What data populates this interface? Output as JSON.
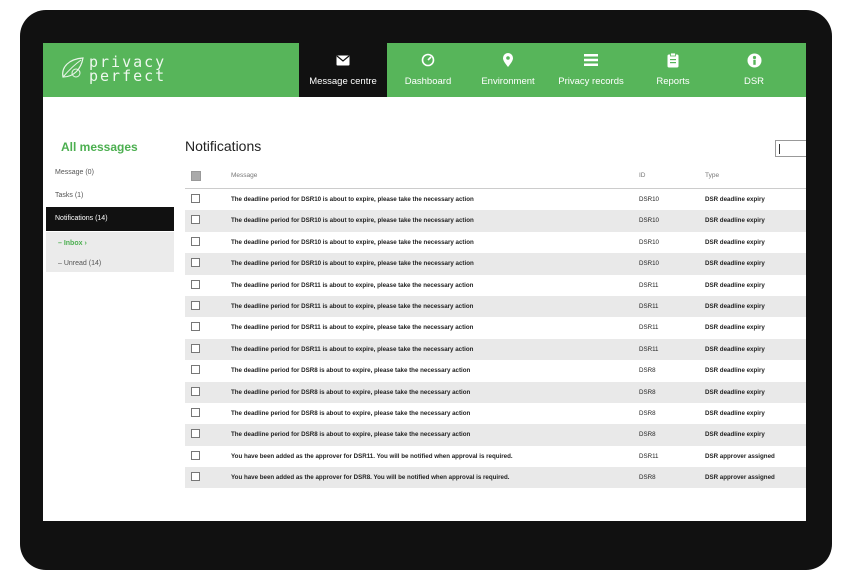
{
  "logo": {
    "line1": "privacy",
    "line2": "perfect"
  },
  "nav": [
    {
      "label": "Message centre",
      "icon": "envelope-icon",
      "active": true
    },
    {
      "label": "Dashboard",
      "icon": "gauge-icon",
      "active": false
    },
    {
      "label": "Environment",
      "icon": "location-pin-icon",
      "active": false
    },
    {
      "label": "Privacy records",
      "icon": "list-icon",
      "active": false
    },
    {
      "label": "Reports",
      "icon": "clipboard-icon",
      "active": false
    },
    {
      "label": "DSR",
      "icon": "person-circle-icon",
      "active": false
    }
  ],
  "sidebar": {
    "title": "All messages",
    "items": [
      {
        "label": "Message (0)"
      },
      {
        "label": "Tasks (1)"
      },
      {
        "label": "Notifications (14)"
      }
    ],
    "sub_items": [
      {
        "label": "– Inbox ›"
      },
      {
        "label": "– Unread (14)"
      }
    ]
  },
  "main": {
    "title": "Notifications",
    "columns": {
      "message": "Message",
      "id": "ID",
      "type": "Type"
    },
    "rows": [
      {
        "message": "The deadline period for DSR10 is about to expire, please take the necessary action",
        "id": "DSR10",
        "type": "DSR deadline expiry"
      },
      {
        "message": "The deadline period for DSR10 is about to expire, please take the necessary action",
        "id": "DSR10",
        "type": "DSR deadline expiry"
      },
      {
        "message": "The deadline period for DSR10 is about to expire, please take the necessary action",
        "id": "DSR10",
        "type": "DSR deadline expiry"
      },
      {
        "message": "The deadline period for DSR10 is about to expire, please take the necessary action",
        "id": "DSR10",
        "type": "DSR deadline expiry"
      },
      {
        "message": "The deadline period for DSR11 is about to expire, please take the necessary action",
        "id": "DSR11",
        "type": "DSR deadline expiry"
      },
      {
        "message": "The deadline period for DSR11 is about to expire, please take the necessary action",
        "id": "DSR11",
        "type": "DSR deadline expiry"
      },
      {
        "message": "The deadline period for DSR11 is about to expire, please take the necessary action",
        "id": "DSR11",
        "type": "DSR deadline expiry"
      },
      {
        "message": "The deadline period for DSR11 is about to expire, please take the necessary action",
        "id": "DSR11",
        "type": "DSR deadline expiry"
      },
      {
        "message": "The deadline period for DSR8 is about to expire, please take the necessary action",
        "id": "DSR8",
        "type": "DSR deadline expiry"
      },
      {
        "message": "The deadline period for DSR8 is about to expire, please take the necessary action",
        "id": "DSR8",
        "type": "DSR deadline expiry"
      },
      {
        "message": "The deadline period for DSR8 is about to expire, please take the necessary action",
        "id": "DSR8",
        "type": "DSR deadline expiry"
      },
      {
        "message": "The deadline period for DSR8 is about to expire, please take the necessary action",
        "id": "DSR8",
        "type": "DSR deadline expiry"
      },
      {
        "message": "You have been added as the approver for DSR11. You will be notified when approval is required.",
        "id": "DSR11",
        "type": "DSR approver assigned"
      },
      {
        "message": "You have been added as the approver for DSR8. You will be notified when approval is required.",
        "id": "DSR8",
        "type": "DSR approver assigned"
      }
    ]
  },
  "colors": {
    "brand_green": "#57b55a",
    "accent_green": "#4caf50",
    "bezel": "#111111"
  }
}
